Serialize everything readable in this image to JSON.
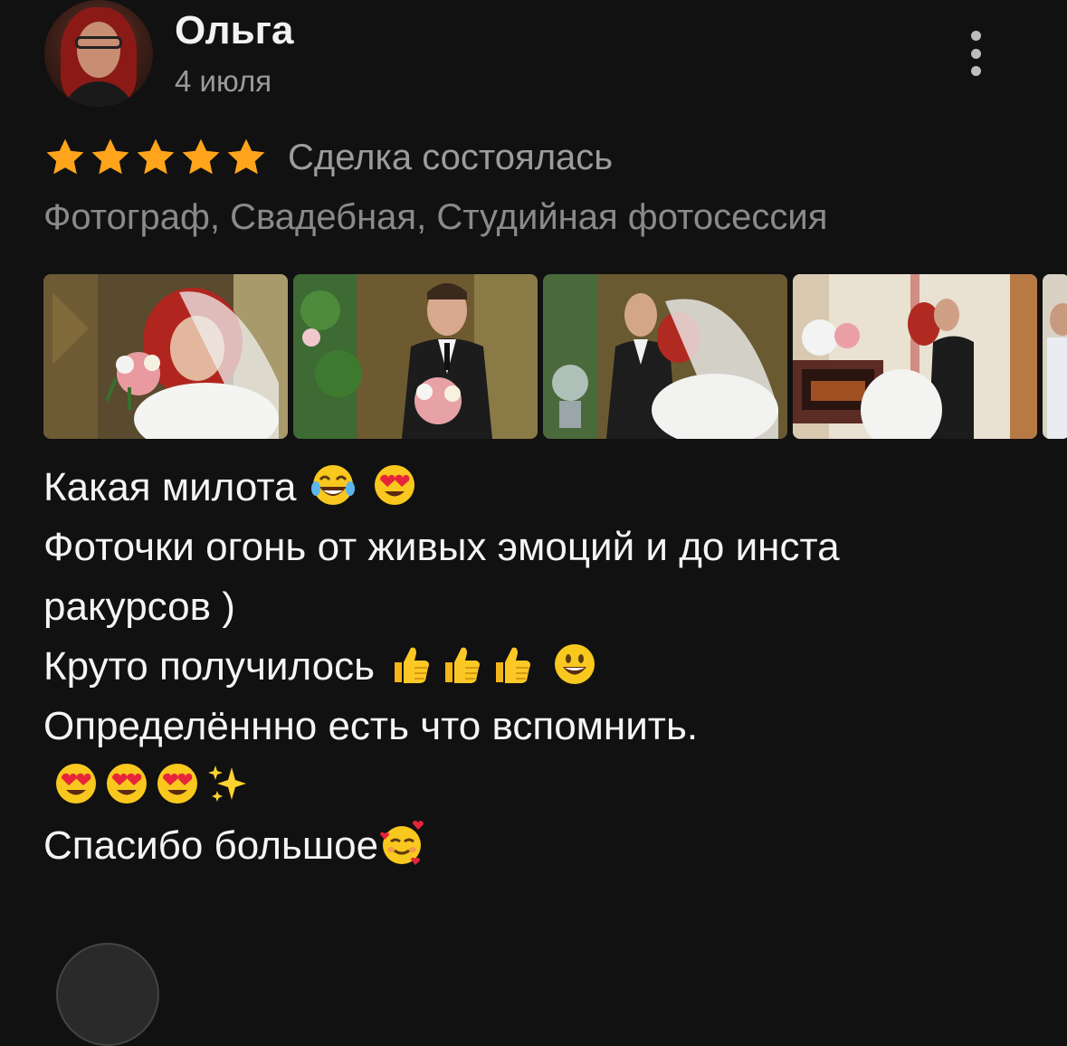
{
  "review": {
    "author": "Ольга",
    "date": "4 июля",
    "rating": 5,
    "rating_max": 5,
    "deal_status": "Сделка состоялась",
    "categories": "Фотограф, Свадебная, Студийная фотосессия",
    "photos": [
      {
        "name": "photo-bride-bouquet"
      },
      {
        "name": "photo-groom-bouquet"
      },
      {
        "name": "photo-couple-laughing"
      },
      {
        "name": "photo-couple-kiss"
      },
      {
        "name": "photo-guests"
      }
    ],
    "text_lines": [
      "Какая милота",
      "Фоточки огонь от живых эмоций и до инста",
      "ракурсов )",
      "Круто получилось",
      "Определённно есть что вспомнить.",
      "",
      "Спасибо большое"
    ],
    "emojis": {
      "line1": [
        "laughing-tears-emoji",
        "heart-eyes-emoji"
      ],
      "line4": [
        "thumbs-up-emoji",
        "thumbs-up-emoji",
        "thumbs-up-emoji",
        "grinning-emoji"
      ],
      "line6": [
        "heart-eyes-emoji",
        "heart-eyes-emoji",
        "heart-eyes-emoji",
        "sparkles-emoji"
      ],
      "line7": [
        "smiling-hearts-emoji"
      ]
    }
  },
  "colors": {
    "background": "#111111",
    "star": "#ffa41b",
    "secondary_text": "#9a9a9a"
  }
}
